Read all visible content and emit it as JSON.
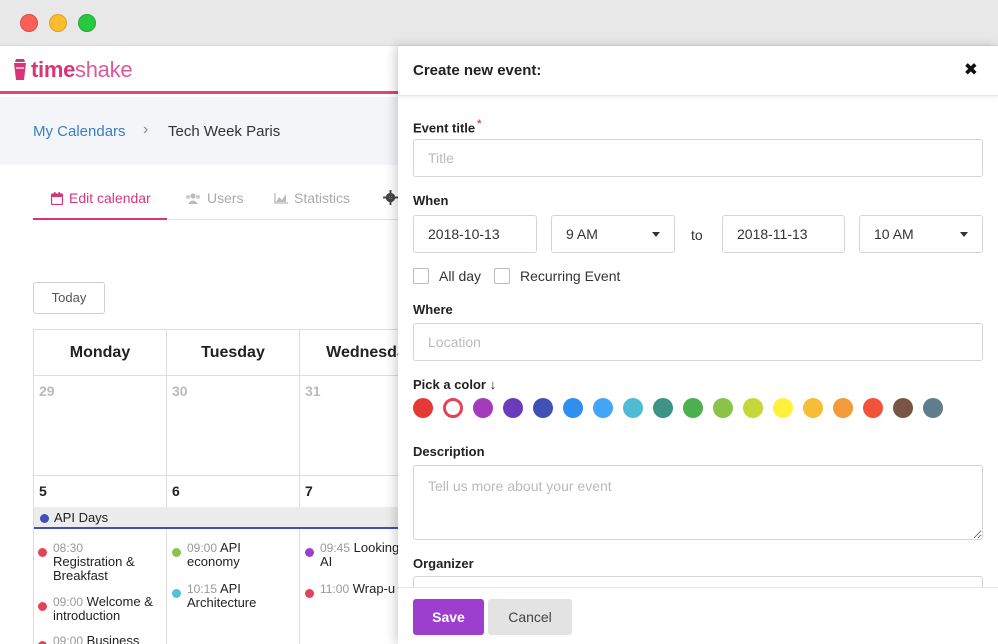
{
  "window": {
    "traffic_lights": [
      "close",
      "minimize",
      "maximize"
    ]
  },
  "brand": {
    "part1": "time",
    "part2": "shake"
  },
  "breadcrumb": {
    "root": "My Calendars",
    "separator": "›",
    "current": "Tech Week Paris"
  },
  "tabs": [
    {
      "label": "Edit calendar",
      "icon": "calendar-icon",
      "active": true
    },
    {
      "label": "Users",
      "icon": "users-icon",
      "active": false
    },
    {
      "label": "Statistics",
      "icon": "chart-icon",
      "active": false
    },
    {
      "label": "",
      "icon": "gear-icon",
      "active": false
    }
  ],
  "calendar": {
    "today_label": "Today",
    "days": [
      "Monday",
      "Tuesday",
      "Wednesda"
    ],
    "week1": [
      "29",
      "30",
      "31"
    ],
    "week2": [
      "5",
      "6",
      "7"
    ],
    "allday_event": {
      "title": "API Days",
      "color": "#3f51b5"
    },
    "events": {
      "monday": [
        {
          "time": "08:30",
          "title": "Registration & Breakfast",
          "color": "#e2435a"
        },
        {
          "time": "09:00",
          "title": "Welcome & introduction",
          "color": "#e2435a"
        },
        {
          "time": "09:00",
          "title": "Business",
          "color": "#e2435a"
        }
      ],
      "tuesday": [
        {
          "time": "09:00",
          "title": "API economy",
          "color": "#8bc34a"
        },
        {
          "time": "10:15",
          "title": "API Architecture",
          "color": "#4fc3d7"
        }
      ],
      "wednesday": [
        {
          "time": "09:45",
          "title": "Looking AI",
          "color": "#9c3fcf"
        },
        {
          "time": "11:00",
          "title": "Wrap-u",
          "color": "#e2435a"
        }
      ]
    }
  },
  "modal": {
    "title": "Create new event:",
    "close_icon": "close-icon",
    "event_title_label": "Event title",
    "required_mark": "*",
    "title_placeholder": "Title",
    "when_label": "When",
    "start_date": "2018-10-13",
    "start_time": "9 AM",
    "to_label": "to",
    "end_date": "2018-11-13",
    "end_time": "10 AM",
    "all_day_label": "All day",
    "recurring_label": "Recurring Event",
    "where_label": "Where",
    "location_placeholder": "Location",
    "color_label": "Pick a color ↓",
    "colors": [
      "#e53935",
      "#ffffff",
      "#a43bbd",
      "#6a3bbd",
      "#3f51b5",
      "#2f8ff0",
      "#42a5f5",
      "#4fbcd3",
      "#3d9486",
      "#4caf50",
      "#8bc34a",
      "#c6d73a",
      "#fff03b",
      "#f7be35",
      "#f39a3a",
      "#f0533a",
      "#7a5546",
      "#607d8b"
    ],
    "selected_color_index": 1,
    "selected_color_ring": "#e2435a",
    "description_label": "Description",
    "description_placeholder": "Tell us more about your event",
    "organizer_label": "Organizer",
    "save_label": "Save",
    "cancel_label": "Cancel"
  }
}
